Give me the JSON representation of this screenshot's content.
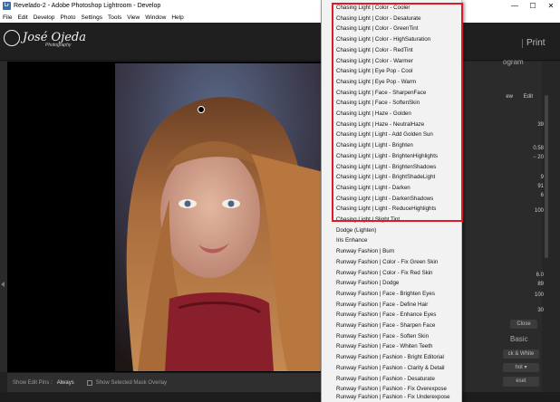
{
  "window": {
    "title": "Revelado-2 - Adobe Photoshop Lightroom - Develop",
    "controls": [
      "—",
      "☐",
      "✕"
    ]
  },
  "menubar": [
    "File",
    "Edit",
    "Develop",
    "Photo",
    "Settings",
    "Tools",
    "View",
    "Window",
    "Help"
  ],
  "identity_plate": {
    "name": "José Ojeda",
    "subtitle": "Photography"
  },
  "modules": {
    "print": "Print",
    "histogram_fragment": "ogram"
  },
  "toolbar": {
    "edit_pins_label": "Show Edit Pins :",
    "edit_pins_value": "Always",
    "mask_overlay_label": "Show Selected Mask Overlay"
  },
  "right_panel": {
    "values": [
      "39",
      "0.58",
      "− 20",
      "9",
      "91",
      "6",
      "100",
      "6.0",
      "89",
      "100",
      "30"
    ],
    "edit_label": "Edit",
    "new_label": "ew",
    "close_label": "Close",
    "basic_label": "Basic",
    "bw_label": "ck & White",
    "shot_label": "hot ▾",
    "reset_label": "eset"
  },
  "menu": {
    "highlighted_items": [
      "Chasing Light | Color - Cooler",
      "Chasing Light | Color - Desaturate",
      "Chasing Light | Color - GreenTint",
      "Chasing Light | Color - HighSaturation",
      "Chasing Light | Color - RedTint",
      "Chasing Light | Color - Warmer",
      "Chasing Light | Eye Pop - Cool",
      "Chasing Light | Eye Pop - Warm",
      "Chasing Light | Face - SharpenFace",
      "Chasing Light | Face - SoftenSkin",
      "Chasing Light | Haze - Golden",
      "Chasing Light | Haze - NeutralHaze",
      "Chasing Light | Light - Add Golden Sun",
      "Chasing Light | Light - Brighten",
      "Chasing Light | Light - BrightenHighlights",
      "Chasing Light | Light - BrightenShadows",
      "Chasing Light | Light - BrightShadeLight",
      "Chasing Light | Light - Darken",
      "Chasing Light | Light - DarkenShadows",
      "Chasing Light | Light - ReduceHighlights",
      "Chasing Light | Slight Tint"
    ],
    "other_items": [
      "Dodge (Lighten)",
      "Iris Enhance",
      "Runway Fashion | Burn",
      "Runway Fashion | Color - Fix Green Skin",
      "Runway Fashion | Color - Fix Red Skin",
      "Runway Fashion | Dodge",
      "Runway Fashion | Face - Brighten Eyes",
      "Runway Fashion | Face - Define Hair",
      "Runway Fashion | Face - Enhance Eyes",
      "Runway Fashion | Face - Sharpen Face",
      "Runway Fashion | Face - Soften Skin",
      "Runway Fashion | Face - Whiten Teeth",
      "Runway Fashion | Fashion - Bright Editorial",
      "Runway Fashion | Fashion - Clarity & Detail",
      "Runway Fashion | Fashion - Desaturate",
      "Runway Fashion | Fashion - Fix Overexpose",
      "Runway Fashion | Fashion - Fix Underexpose"
    ]
  },
  "colors": {
    "highlight_border": "#e0182a",
    "menu_bg": "#f2f2f2",
    "app_bg": "#222222"
  }
}
